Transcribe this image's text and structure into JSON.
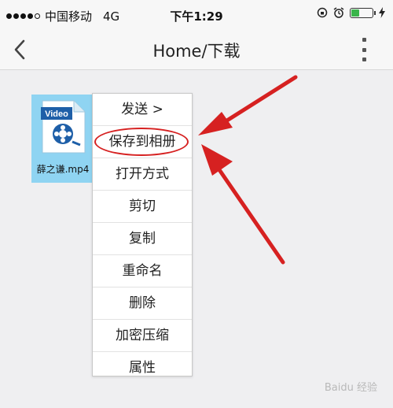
{
  "status_bar": {
    "carrier": "中国移动",
    "network": "4G",
    "time": "下午1:29",
    "battery_level": 0.35,
    "signal_bars": 4
  },
  "nav": {
    "title": "Home/下载"
  },
  "file": {
    "badge": "Video",
    "name": "薛之谦.mp4"
  },
  "menu": {
    "items": [
      "发送 >",
      "保存到相册",
      "打开方式",
      "剪切",
      "复制",
      "重命名",
      "删除",
      "加密压缩",
      "属性"
    ]
  },
  "colors": {
    "accent_red": "#d62121",
    "tile_blue": "#8fd4f2",
    "video_blue": "#1e5fa8"
  }
}
